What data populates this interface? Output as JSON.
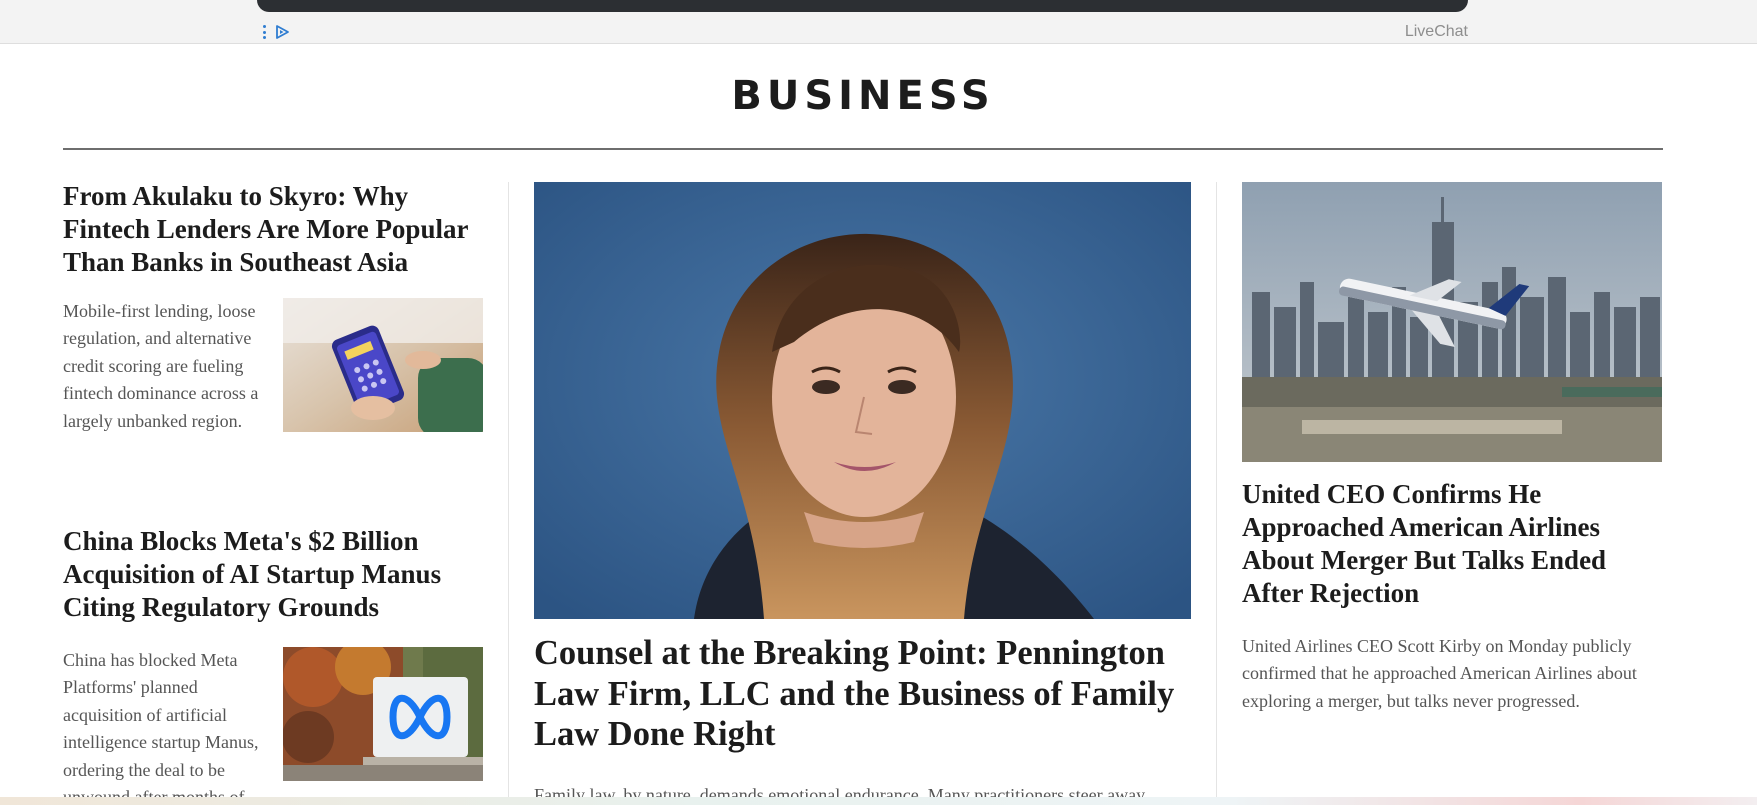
{
  "ad": {
    "label": "LiveChat",
    "icons": [
      "more-vertical-icon",
      "adchoices-icon"
    ]
  },
  "section": {
    "title": "BUSINESS"
  },
  "left_stories": [
    {
      "headline": "From Akulaku to Skyro: Why Fintech Lenders Are More Popular Than Banks in Southeast Asia",
      "dek": "Mobile-first lending, loose regulation, and alternative credit scoring are fueling fintech dominance across a largely unbanked region.",
      "image": "smartphone-payment-app-photo"
    },
    {
      "headline": "China Blocks Meta's $2 Billion Acquisition of AI Startup Manus Citing Regulatory Grounds",
      "dek": "China has blocked Meta Platforms' planned acquisition of artificial intelligence startup Manus, ordering the deal to be unwound after months of regulatory review.",
      "image": "meta-headquarters-sign-photo"
    }
  ],
  "center_story": {
    "headline": "Counsel at the Breaking Point: Pennington Law Firm, LLC and the Business of Family Law Done Right",
    "dek": "Family law, by nature, demands emotional endurance. Many practitioners steer away",
    "image": "attorney-portrait-photo"
  },
  "right_story": {
    "headline": "United CEO Confirms He Approached American Airlines About Merger But Talks Ended After Rejection",
    "dek": "United Airlines CEO Scott Kirby on Monday publicly confirmed that he approached American Airlines about exploring a merger, but talks never progressed.",
    "image": "airplane-over-skyline-photo"
  },
  "colors": {
    "headline": "#1c1c1c",
    "dek": "#555555",
    "rule": "#6e6e6e",
    "ad_banner": "#2c2f33"
  }
}
